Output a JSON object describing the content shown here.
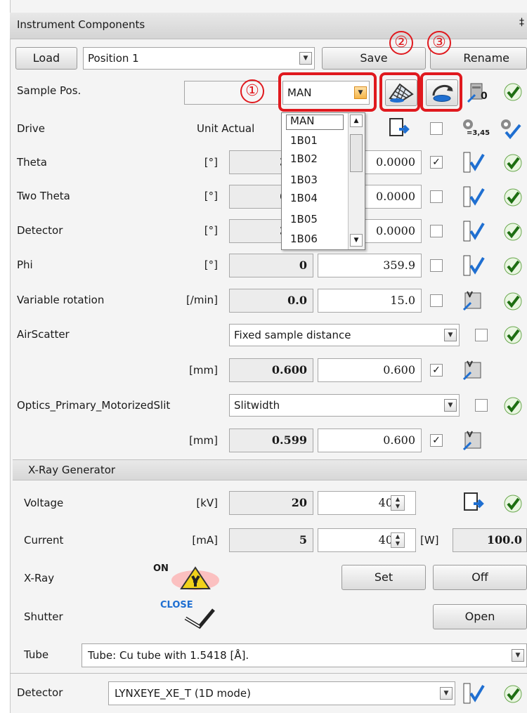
{
  "window": {
    "title": "Instrument Components",
    "pin": "‡"
  },
  "toolbar": {
    "load_label": "Load",
    "position_value": "Position 1",
    "save_label": "Save",
    "rename_label": "Rename"
  },
  "sample_pos": {
    "label": "Sample Pos.",
    "mode_value": "MAN"
  },
  "annotations": {
    "one": "①",
    "two": "②",
    "three": "③"
  },
  "dropdown": {
    "items": [
      "MAN",
      "1B01",
      "1B02",
      "1B03",
      "1B04",
      "1B05",
      "1B06"
    ]
  },
  "drive": {
    "label": "Drive",
    "unit_actual": "Unit Actual"
  },
  "axes": [
    {
      "name": "Theta",
      "unit": "[°]",
      "actual": "30.0",
      "target": "0.0000",
      "checked": true
    },
    {
      "name": "Two Theta",
      "unit": "[°]",
      "actual": "60.0",
      "target": "0.0000",
      "checked": false
    },
    {
      "name": "Detector",
      "unit": "[°]",
      "actual": "30.0",
      "target": "0.0000",
      "checked": false
    },
    {
      "name": "Phi",
      "unit": "[°]",
      "actual": "0",
      "target": "359.9",
      "checked": false
    },
    {
      "name": "Variable rotation",
      "unit": "[/min]",
      "actual": "0.0",
      "target": "15.0",
      "checked": false
    }
  ],
  "airscatter": {
    "label": "AirScatter",
    "mode": "Fixed sample distance",
    "unit": "[mm]",
    "actual": "0.600",
    "target": "0.600"
  },
  "optics": {
    "label": "Optics_Primary_MotorizedSlit",
    "mode": "Slitwidth",
    "unit": "[mm]",
    "actual": "0.599",
    "target": "0.600"
  },
  "xray_generator": {
    "title": "X-Ray Generator",
    "voltage": {
      "label": "Voltage",
      "unit": "[kV]",
      "actual": "20",
      "target": "40"
    },
    "current": {
      "label": "Current",
      "unit": "[mA]",
      "actual": "5",
      "target": "40",
      "power_unit": "[W]",
      "power": "100.0"
    },
    "xray": {
      "label": "X-Ray",
      "status": "ON",
      "set_label": "Set",
      "off_label": "Off"
    },
    "shutter": {
      "label": "Shutter",
      "status": "CLOSE",
      "open_label": "Open"
    },
    "tube": {
      "label": "Tube",
      "value": "Tube: Cu tube with 1.5418 [Å]."
    }
  },
  "detector": {
    "label": "Detector",
    "value": "LYNXEYE_XE_T (1D mode)"
  },
  "icon_text": {
    "count_zero": "0",
    "param_value": "=3,45"
  },
  "colors": {
    "annotation_red": "#e0191e",
    "ok_green": "#2a8a1a",
    "check_blue": "#1f6fd1"
  }
}
